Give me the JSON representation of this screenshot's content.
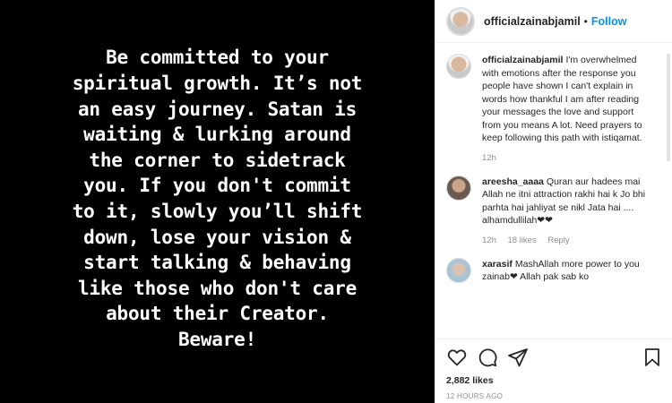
{
  "post": {
    "text": "Be committed to your\nspiritual growth. It’s not\nan easy journey. Satan is\nwaiting & lurking around\nthe corner to sidetrack\nyou. If you don't commit\nto it, slowly you’ll shift\ndown, lose your vision &\nstart talking & behaving\nlike those who don't care\nabout their Creator.\nBeware!"
  },
  "header": {
    "username": "officialzainabjamil",
    "separator": "•",
    "follow_label": "Follow"
  },
  "comments": [
    {
      "username": "officialzainabjamil",
      "text": "I'm overwhelmed with emotions after the response you people have shown I can't explain in words how thankful I am after reading your messages the love and support from you means A lot. Need prayers to keep following this path with istiqamat.",
      "time": "12h"
    },
    {
      "username": "areesha_aaaa",
      "text": "Quran aur hadees mai Allah ne itni attraction rakhi hai k Jo bhi parhta hai jahliyat se nikl Jata hai .... alhamdullilah❤❤",
      "time": "12h",
      "likes": "18 likes",
      "reply": "Reply"
    },
    {
      "username": "xarasif",
      "text": "MashAllah more power to you zainab❤ Allah pak sab ko",
      "time": ""
    }
  ],
  "actions": {
    "icons": [
      "heart-icon",
      "comment-icon",
      "share-icon",
      "bookmark-icon"
    ],
    "likes": "2,882 likes",
    "time_ago": "12 HOURS AGO"
  },
  "colors": {
    "accent": "#0095f6",
    "muted": "#8e8e8e",
    "text": "#262626"
  }
}
